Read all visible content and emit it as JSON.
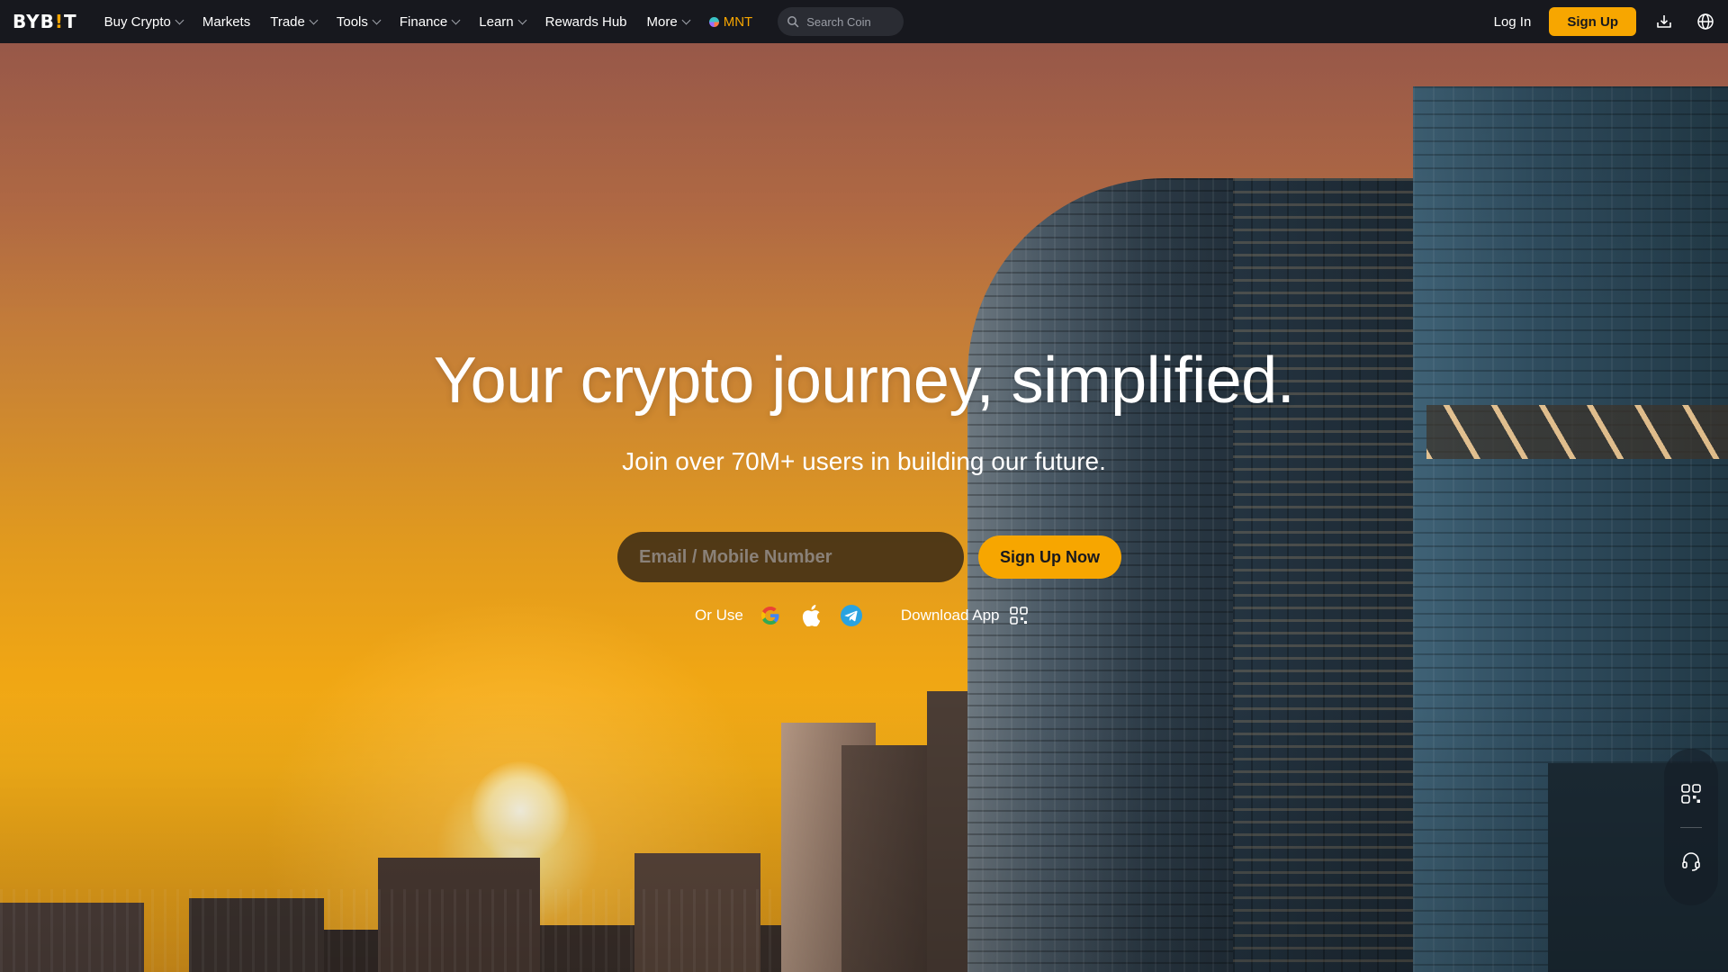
{
  "brand": {
    "logo_text_a": "BYB",
    "logo_text_bang": "!",
    "logo_text_b": "T",
    "accent": "#f7a600",
    "nav_bg": "#17181e"
  },
  "nav": {
    "items": [
      {
        "label": "Buy Crypto",
        "dropdown": true
      },
      {
        "label": "Markets",
        "dropdown": false
      },
      {
        "label": "Trade",
        "dropdown": true
      },
      {
        "label": "Tools",
        "dropdown": true
      },
      {
        "label": "Finance",
        "dropdown": true
      },
      {
        "label": "Learn",
        "dropdown": true
      },
      {
        "label": "Rewards Hub",
        "dropdown": false
      },
      {
        "label": "More",
        "dropdown": true
      }
    ],
    "mnt_label": "MNT",
    "search_placeholder": "Search Coin",
    "login_label": "Log In",
    "signup_label": "Sign Up",
    "icons": [
      "download-icon",
      "globe-icon"
    ]
  },
  "hero": {
    "title": "Your crypto journey, simplified.",
    "subtitle": "Join over 70M+ users in building our future.",
    "email_placeholder": "Email / Mobile Number",
    "signup_button": "Sign Up Now",
    "or_use_label": "Or Use",
    "social_icons": [
      "google-icon",
      "apple-icon",
      "telegram-icon"
    ],
    "download_app_label": "Download App"
  },
  "floating_widget": {
    "icons": [
      "qr-code-icon",
      "support-headset-icon"
    ]
  }
}
